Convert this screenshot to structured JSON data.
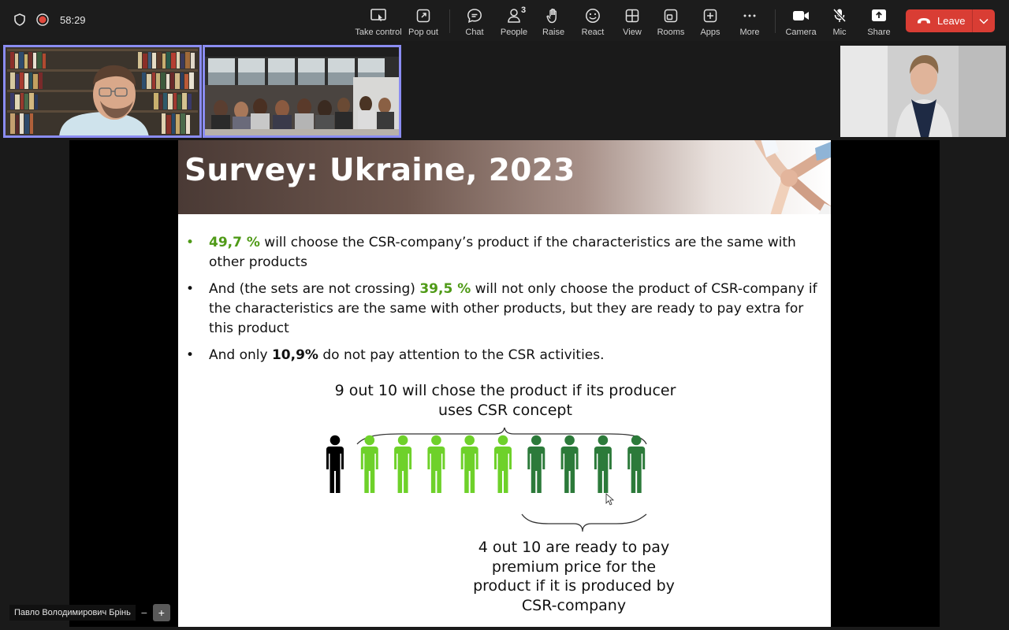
{
  "topbar": {
    "timer": "58:29",
    "tools": [
      {
        "label": "Take control",
        "icon": "take-control-icon"
      },
      {
        "label": "Pop out",
        "icon": "pop-out-icon"
      },
      {
        "label": "Chat",
        "icon": "chat-icon"
      },
      {
        "label": "People",
        "icon": "people-icon",
        "count": "3"
      },
      {
        "label": "Raise",
        "icon": "raise-hand-icon"
      },
      {
        "label": "React",
        "icon": "react-icon"
      },
      {
        "label": "View",
        "icon": "view-icon"
      },
      {
        "label": "Rooms",
        "icon": "rooms-icon"
      },
      {
        "label": "Apps",
        "icon": "apps-icon"
      },
      {
        "label": "More",
        "icon": "more-icon"
      },
      {
        "label": "Camera",
        "icon": "camera-icon"
      },
      {
        "label": "Mic",
        "icon": "mic-off-icon"
      },
      {
        "label": "Share",
        "icon": "share-icon"
      }
    ],
    "leave_label": "Leave"
  },
  "slide": {
    "title": "Survey: Ukraine, 2023",
    "bullets": [
      {
        "highlight": "49,7 %",
        "text": " will choose the  CSR-company’s product if the characteristics are the same with other products"
      },
      {
        "pre": "And (the sets are not crossing) ",
        "highlight": "39,5 %",
        "text": " will not only choose the product of CSR-company if the characteristics are the same with other products, but they are ready to pay extra for this product"
      },
      {
        "pre": "And only ",
        "bold": "10,9%",
        "text": " do not pay attention to the CSR activities."
      }
    ],
    "caption_top": "9 out 10 will chose the product if its producer uses CSR concept",
    "caption_bottom": "4 out 10 are ready to pay premium price for the product if it is produced by CSR-company",
    "figures": {
      "total": 10,
      "black": 1,
      "light_green": 5,
      "dark_green": 4
    },
    "colors": {
      "black": "#000000",
      "light_green": "#6ed12a",
      "dark_green": "#2c7a3a",
      "highlight_text": "#4f9a17"
    }
  },
  "participant": {
    "name": "Павло Володимирович Брінь"
  },
  "colors": {
    "leave": "#d93d34",
    "selected_outline": "#8a8cf2",
    "topbar": "#1c1c1c"
  }
}
